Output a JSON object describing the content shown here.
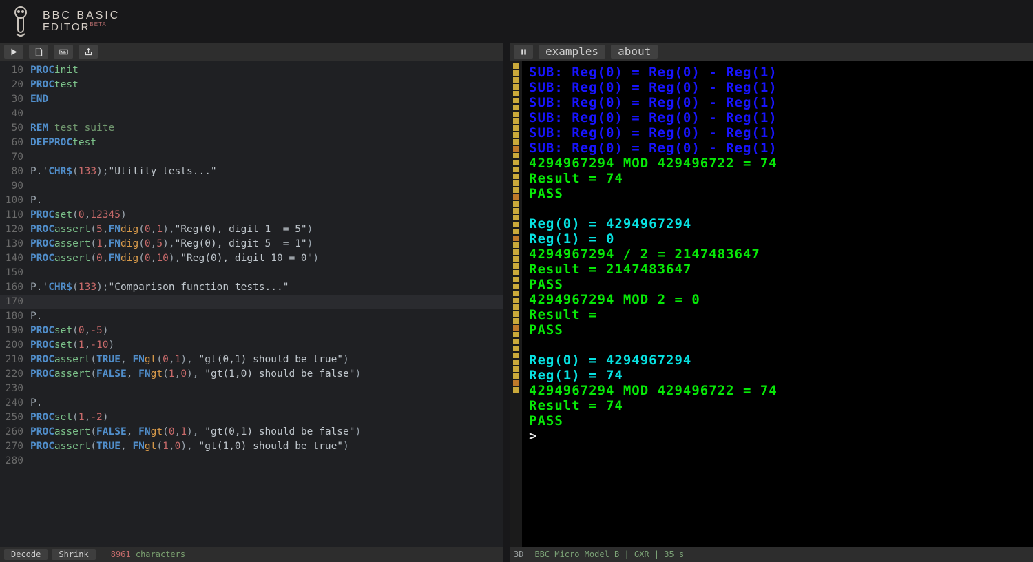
{
  "header": {
    "title_line1": "BBC BASIC",
    "title_line2": "EDITOR",
    "beta": "BETA"
  },
  "left_toolbar": {
    "run": "run-icon",
    "new": "new-file-icon",
    "keyboard": "keyboard-icon",
    "share": "share-icon"
  },
  "right_toolbar": {
    "pause": "pause-icon",
    "examples": "examples",
    "about": "about"
  },
  "editor": {
    "lines": [
      {
        "n": "10",
        "hl": false,
        "tokens": [
          {
            "c": "t-kw",
            "t": "PROC"
          },
          {
            "c": "t-pr",
            "t": "init"
          }
        ]
      },
      {
        "n": "20",
        "hl": false,
        "tokens": [
          {
            "c": "t-kw",
            "t": "PROC"
          },
          {
            "c": "t-pr",
            "t": "test"
          }
        ]
      },
      {
        "n": "30",
        "hl": false,
        "tokens": [
          {
            "c": "t-kw",
            "t": "END"
          }
        ]
      },
      {
        "n": "40",
        "hl": false,
        "tokens": []
      },
      {
        "n": "50",
        "hl": false,
        "tokens": [
          {
            "c": "t-kw",
            "t": "REM"
          },
          {
            "c": "t-cm",
            "t": " test suite"
          }
        ]
      },
      {
        "n": "60",
        "hl": false,
        "tokens": [
          {
            "c": "t-kw",
            "t": "DEFPROC"
          },
          {
            "c": "t-pr",
            "t": "test"
          }
        ]
      },
      {
        "n": "70",
        "hl": false,
        "tokens": []
      },
      {
        "n": "80",
        "hl": false,
        "tokens": [
          {
            "c": "t-pun",
            "t": "P.'"
          },
          {
            "c": "t-kw",
            "t": "CHR$"
          },
          {
            "c": "t-pun",
            "t": "("
          },
          {
            "c": "t-num",
            "t": "133"
          },
          {
            "c": "t-pun",
            "t": ");"
          },
          {
            "c": "t-str",
            "t": "\"Utility tests...\""
          }
        ]
      },
      {
        "n": "90",
        "hl": false,
        "tokens": []
      },
      {
        "n": "100",
        "hl": false,
        "tokens": [
          {
            "c": "t-pun",
            "t": "P."
          }
        ]
      },
      {
        "n": "110",
        "hl": false,
        "tokens": [
          {
            "c": "t-kw",
            "t": "PROC"
          },
          {
            "c": "t-pr",
            "t": "set"
          },
          {
            "c": "t-pun",
            "t": "("
          },
          {
            "c": "t-num",
            "t": "0"
          },
          {
            "c": "t-pun",
            "t": ","
          },
          {
            "c": "t-num",
            "t": "12345"
          },
          {
            "c": "t-pun",
            "t": ")"
          }
        ]
      },
      {
        "n": "120",
        "hl": false,
        "tokens": [
          {
            "c": "t-kw",
            "t": "PROC"
          },
          {
            "c": "t-pr",
            "t": "assert"
          },
          {
            "c": "t-pun",
            "t": "("
          },
          {
            "c": "t-num",
            "t": "5"
          },
          {
            "c": "t-pun",
            "t": ","
          },
          {
            "c": "t-kw",
            "t": "FN"
          },
          {
            "c": "t-fn",
            "t": "dig"
          },
          {
            "c": "t-pun",
            "t": "("
          },
          {
            "c": "t-num",
            "t": "0"
          },
          {
            "c": "t-pun",
            "t": ","
          },
          {
            "c": "t-num",
            "t": "1"
          },
          {
            "c": "t-pun",
            "t": "),"
          },
          {
            "c": "t-str",
            "t": "\"Reg(0), digit 1  = 5\""
          },
          {
            "c": "t-pun",
            "t": ")"
          }
        ]
      },
      {
        "n": "130",
        "hl": false,
        "tokens": [
          {
            "c": "t-kw",
            "t": "PROC"
          },
          {
            "c": "t-pr",
            "t": "assert"
          },
          {
            "c": "t-pun",
            "t": "("
          },
          {
            "c": "t-num",
            "t": "1"
          },
          {
            "c": "t-pun",
            "t": ","
          },
          {
            "c": "t-kw",
            "t": "FN"
          },
          {
            "c": "t-fn",
            "t": "dig"
          },
          {
            "c": "t-pun",
            "t": "("
          },
          {
            "c": "t-num",
            "t": "0"
          },
          {
            "c": "t-pun",
            "t": ","
          },
          {
            "c": "t-num",
            "t": "5"
          },
          {
            "c": "t-pun",
            "t": "),"
          },
          {
            "c": "t-str",
            "t": "\"Reg(0), digit 5  = 1\""
          },
          {
            "c": "t-pun",
            "t": ")"
          }
        ]
      },
      {
        "n": "140",
        "hl": false,
        "tokens": [
          {
            "c": "t-kw",
            "t": "PROC"
          },
          {
            "c": "t-pr",
            "t": "assert"
          },
          {
            "c": "t-pun",
            "t": "("
          },
          {
            "c": "t-num",
            "t": "0"
          },
          {
            "c": "t-pun",
            "t": ","
          },
          {
            "c": "t-kw",
            "t": "FN"
          },
          {
            "c": "t-fn",
            "t": "dig"
          },
          {
            "c": "t-pun",
            "t": "("
          },
          {
            "c": "t-num",
            "t": "0"
          },
          {
            "c": "t-pun",
            "t": ","
          },
          {
            "c": "t-num",
            "t": "10"
          },
          {
            "c": "t-pun",
            "t": "),"
          },
          {
            "c": "t-str",
            "t": "\"Reg(0), digit 10 = 0\""
          },
          {
            "c": "t-pun",
            "t": ")"
          }
        ]
      },
      {
        "n": "150",
        "hl": false,
        "tokens": []
      },
      {
        "n": "160",
        "hl": false,
        "tokens": [
          {
            "c": "t-pun",
            "t": "P.'"
          },
          {
            "c": "t-kw",
            "t": "CHR$"
          },
          {
            "c": "t-pun",
            "t": "("
          },
          {
            "c": "t-num",
            "t": "133"
          },
          {
            "c": "t-pun",
            "t": ");"
          },
          {
            "c": "t-str",
            "t": "\"Comparison function tests...\""
          }
        ]
      },
      {
        "n": "170",
        "hl": true,
        "tokens": []
      },
      {
        "n": "180",
        "hl": false,
        "tokens": [
          {
            "c": "t-pun",
            "t": "P."
          }
        ]
      },
      {
        "n": "190",
        "hl": false,
        "tokens": [
          {
            "c": "t-kw",
            "t": "PROC"
          },
          {
            "c": "t-pr",
            "t": "set"
          },
          {
            "c": "t-pun",
            "t": "("
          },
          {
            "c": "t-num",
            "t": "0"
          },
          {
            "c": "t-pun",
            "t": ","
          },
          {
            "c": "t-num",
            "t": "-5"
          },
          {
            "c": "t-pun",
            "t": ")"
          }
        ]
      },
      {
        "n": "200",
        "hl": false,
        "tokens": [
          {
            "c": "t-kw",
            "t": "PROC"
          },
          {
            "c": "t-pr",
            "t": "set"
          },
          {
            "c": "t-pun",
            "t": "("
          },
          {
            "c": "t-num",
            "t": "1"
          },
          {
            "c": "t-pun",
            "t": ","
          },
          {
            "c": "t-num",
            "t": "-10"
          },
          {
            "c": "t-pun",
            "t": ")"
          }
        ]
      },
      {
        "n": "210",
        "hl": false,
        "tokens": [
          {
            "c": "t-kw",
            "t": "PROC"
          },
          {
            "c": "t-pr",
            "t": "assert"
          },
          {
            "c": "t-pun",
            "t": "("
          },
          {
            "c": "t-kw",
            "t": "TRUE"
          },
          {
            "c": "t-pun",
            "t": ", "
          },
          {
            "c": "t-kw",
            "t": "FN"
          },
          {
            "c": "t-fn",
            "t": "gt"
          },
          {
            "c": "t-pun",
            "t": "("
          },
          {
            "c": "t-num",
            "t": "0"
          },
          {
            "c": "t-pun",
            "t": ","
          },
          {
            "c": "t-num",
            "t": "1"
          },
          {
            "c": "t-pun",
            "t": "), "
          },
          {
            "c": "t-str",
            "t": "\"gt(0,1) should be true\""
          },
          {
            "c": "t-pun",
            "t": ")"
          }
        ]
      },
      {
        "n": "220",
        "hl": false,
        "tokens": [
          {
            "c": "t-kw",
            "t": "PROC"
          },
          {
            "c": "t-pr",
            "t": "assert"
          },
          {
            "c": "t-pun",
            "t": "("
          },
          {
            "c": "t-kw",
            "t": "FALSE"
          },
          {
            "c": "t-pun",
            "t": ", "
          },
          {
            "c": "t-kw",
            "t": "FN"
          },
          {
            "c": "t-fn",
            "t": "gt"
          },
          {
            "c": "t-pun",
            "t": "("
          },
          {
            "c": "t-num",
            "t": "1"
          },
          {
            "c": "t-pun",
            "t": ","
          },
          {
            "c": "t-num",
            "t": "0"
          },
          {
            "c": "t-pun",
            "t": "), "
          },
          {
            "c": "t-str",
            "t": "\"gt(1,0) should be false\""
          },
          {
            "c": "t-pun",
            "t": ")"
          }
        ]
      },
      {
        "n": "230",
        "hl": false,
        "tokens": []
      },
      {
        "n": "240",
        "hl": false,
        "tokens": [
          {
            "c": "t-pun",
            "t": "P."
          }
        ]
      },
      {
        "n": "250",
        "hl": false,
        "tokens": [
          {
            "c": "t-kw",
            "t": "PROC"
          },
          {
            "c": "t-pr",
            "t": "set"
          },
          {
            "c": "t-pun",
            "t": "("
          },
          {
            "c": "t-num",
            "t": "1"
          },
          {
            "c": "t-pun",
            "t": ","
          },
          {
            "c": "t-num",
            "t": "-2"
          },
          {
            "c": "t-pun",
            "t": ")"
          }
        ]
      },
      {
        "n": "260",
        "hl": false,
        "tokens": [
          {
            "c": "t-kw",
            "t": "PROC"
          },
          {
            "c": "t-pr",
            "t": "assert"
          },
          {
            "c": "t-pun",
            "t": "("
          },
          {
            "c": "t-kw",
            "t": "FALSE"
          },
          {
            "c": "t-pun",
            "t": ", "
          },
          {
            "c": "t-kw",
            "t": "FN"
          },
          {
            "c": "t-fn",
            "t": "gt"
          },
          {
            "c": "t-pun",
            "t": "("
          },
          {
            "c": "t-num",
            "t": "0"
          },
          {
            "c": "t-pun",
            "t": ","
          },
          {
            "c": "t-num",
            "t": "1"
          },
          {
            "c": "t-pun",
            "t": "), "
          },
          {
            "c": "t-str",
            "t": "\"gt(0,1) should be false\""
          },
          {
            "c": "t-pun",
            "t": ")"
          }
        ]
      },
      {
        "n": "270",
        "hl": false,
        "tokens": [
          {
            "c": "t-kw",
            "t": "PROC"
          },
          {
            "c": "t-pr",
            "t": "assert"
          },
          {
            "c": "t-pun",
            "t": "("
          },
          {
            "c": "t-kw",
            "t": "TRUE"
          },
          {
            "c": "t-pun",
            "t": ", "
          },
          {
            "c": "t-kw",
            "t": "FN"
          },
          {
            "c": "t-fn",
            "t": "gt"
          },
          {
            "c": "t-pun",
            "t": "("
          },
          {
            "c": "t-num",
            "t": "1"
          },
          {
            "c": "t-pun",
            "t": ","
          },
          {
            "c": "t-num",
            "t": "0"
          },
          {
            "c": "t-pun",
            "t": "), "
          },
          {
            "c": "t-str",
            "t": "\"gt(1,0) should be true\""
          },
          {
            "c": "t-pun",
            "t": ")"
          }
        ]
      },
      {
        "n": "280",
        "hl": false,
        "tokens": []
      }
    ]
  },
  "editor_footer": {
    "decode": "Decode",
    "shrink": "Shrink",
    "count": "8961",
    "count_label": " characters"
  },
  "cassette_segments": [
    "y",
    "y",
    "y",
    "y",
    "y",
    "y",
    "y",
    "y",
    "y",
    "y",
    "y",
    "y",
    "o",
    "y",
    "y",
    "y",
    "y",
    "y",
    "y",
    "o",
    "y",
    "y",
    "y",
    "y",
    "y",
    "o",
    "y",
    "y",
    "y",
    "y",
    "y",
    "y",
    "y",
    "y",
    "y",
    "y",
    "y",
    "y",
    "o",
    "y",
    "y",
    "y",
    "y",
    "y",
    "y",
    "y",
    "o",
    "y"
  ],
  "screen_lines": [
    {
      "cls": "c-blue",
      "t": "SUB: Reg(0) = Reg(0) - Reg(1)"
    },
    {
      "cls": "c-blue",
      "t": "SUB: Reg(0) = Reg(0) - Reg(1)"
    },
    {
      "cls": "c-blue",
      "t": "SUB: Reg(0) = Reg(0) - Reg(1)"
    },
    {
      "cls": "c-blue",
      "t": "SUB: Reg(0) = Reg(0) - Reg(1)"
    },
    {
      "cls": "c-blue",
      "t": "SUB: Reg(0) = Reg(0) - Reg(1)"
    },
    {
      "cls": "c-blue",
      "t": "SUB: Reg(0) = Reg(0) - Reg(1)"
    },
    {
      "cls": "c-green",
      "t": "4294967294 MOD 429496722 = 74"
    },
    {
      "cls": "c-green",
      "t": "Result = 74"
    },
    {
      "cls": "c-green",
      "t": "PASS"
    },
    {
      "cls": "c-green",
      "t": ""
    },
    {
      "cls": "c-cyan",
      "t": "Reg(0) = 4294967294"
    },
    {
      "cls": "c-cyan",
      "t": "Reg(1) = 0"
    },
    {
      "cls": "c-green",
      "t": "4294967294 / 2 = 2147483647"
    },
    {
      "cls": "c-green",
      "t": "Result = 2147483647"
    },
    {
      "cls": "c-green",
      "t": "PASS"
    },
    {
      "cls": "c-green",
      "t": "4294967294 MOD 2 = 0"
    },
    {
      "cls": "c-green",
      "t": "Result ="
    },
    {
      "cls": "c-green",
      "t": "PASS"
    },
    {
      "cls": "c-green",
      "t": ""
    },
    {
      "cls": "c-cyan",
      "t": "Reg(0) = 4294967294"
    },
    {
      "cls": "c-cyan",
      "t": "Reg(1) = 74"
    },
    {
      "cls": "c-green",
      "t": "4294967294 MOD 429496722 = 74"
    },
    {
      "cls": "c-green",
      "t": "Result = 74"
    },
    {
      "cls": "c-green",
      "t": "PASS"
    },
    {
      "cls": "c-white",
      "t": ">"
    }
  ],
  "right_footer": {
    "mode": "3D",
    "status": "BBC Micro Model B | GXR | 35 s"
  }
}
